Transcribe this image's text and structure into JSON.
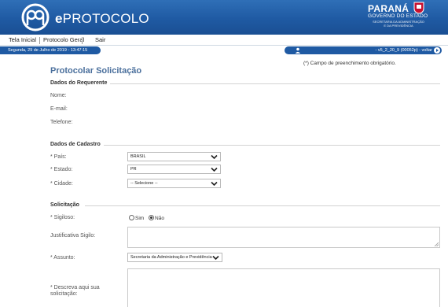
{
  "header": {
    "app_name_bold": "e",
    "app_name": "PROTOCOLO",
    "state_name": "PARANÁ",
    "gov_line": "GOVERNO DO ESTADO",
    "secretaria_line1": "SECRETARIA DA ADMINISTRAÇÃO",
    "secretaria_line2": "E DA PREVIDÊNCIA",
    "brand_color": "#1f5aa3"
  },
  "menu": {
    "items": [
      {
        "label": "Tela Inicial"
      },
      {
        "label": "Protocolo Geral"
      },
      {
        "label": "Sair"
      }
    ]
  },
  "status": {
    "date": "Segunda, 29 de Julho de 2019 - 13:47:15",
    "version": "- v5_2_20_9 (00052p) - voltar"
  },
  "required_note": "(*) Campo de preenchimento obrigatório.",
  "page_title": "Protocolar Solicitação",
  "requerente": {
    "title": "Dados do Requerente",
    "nome_label": "Nome:",
    "email_label": "E-mail:",
    "telefone_label": "Telefone:"
  },
  "cadastro": {
    "title": "Dados de Cadastro",
    "pais_label": "* País:",
    "pais_value": "BRASIL",
    "estado_label": "* Estado:",
    "estado_value": "PR",
    "cidade_label": "* Cidade:",
    "cidade_value": "-- Selecione --"
  },
  "solicitacao": {
    "title": "Solicitação",
    "sigiloso_label": "* Sigiloso:",
    "sim_label": "Sim",
    "nao_label": "Não",
    "sigiloso_selected": "Não",
    "justificativa_label": "Justificativa Sigilo:",
    "assunto_label": "* Assunto:",
    "assunto_value": "Secretaria da Administração e Previdência",
    "descreva_label_1": "* Descreva aqui sua",
    "descreva_label_2": "solicitação:"
  }
}
